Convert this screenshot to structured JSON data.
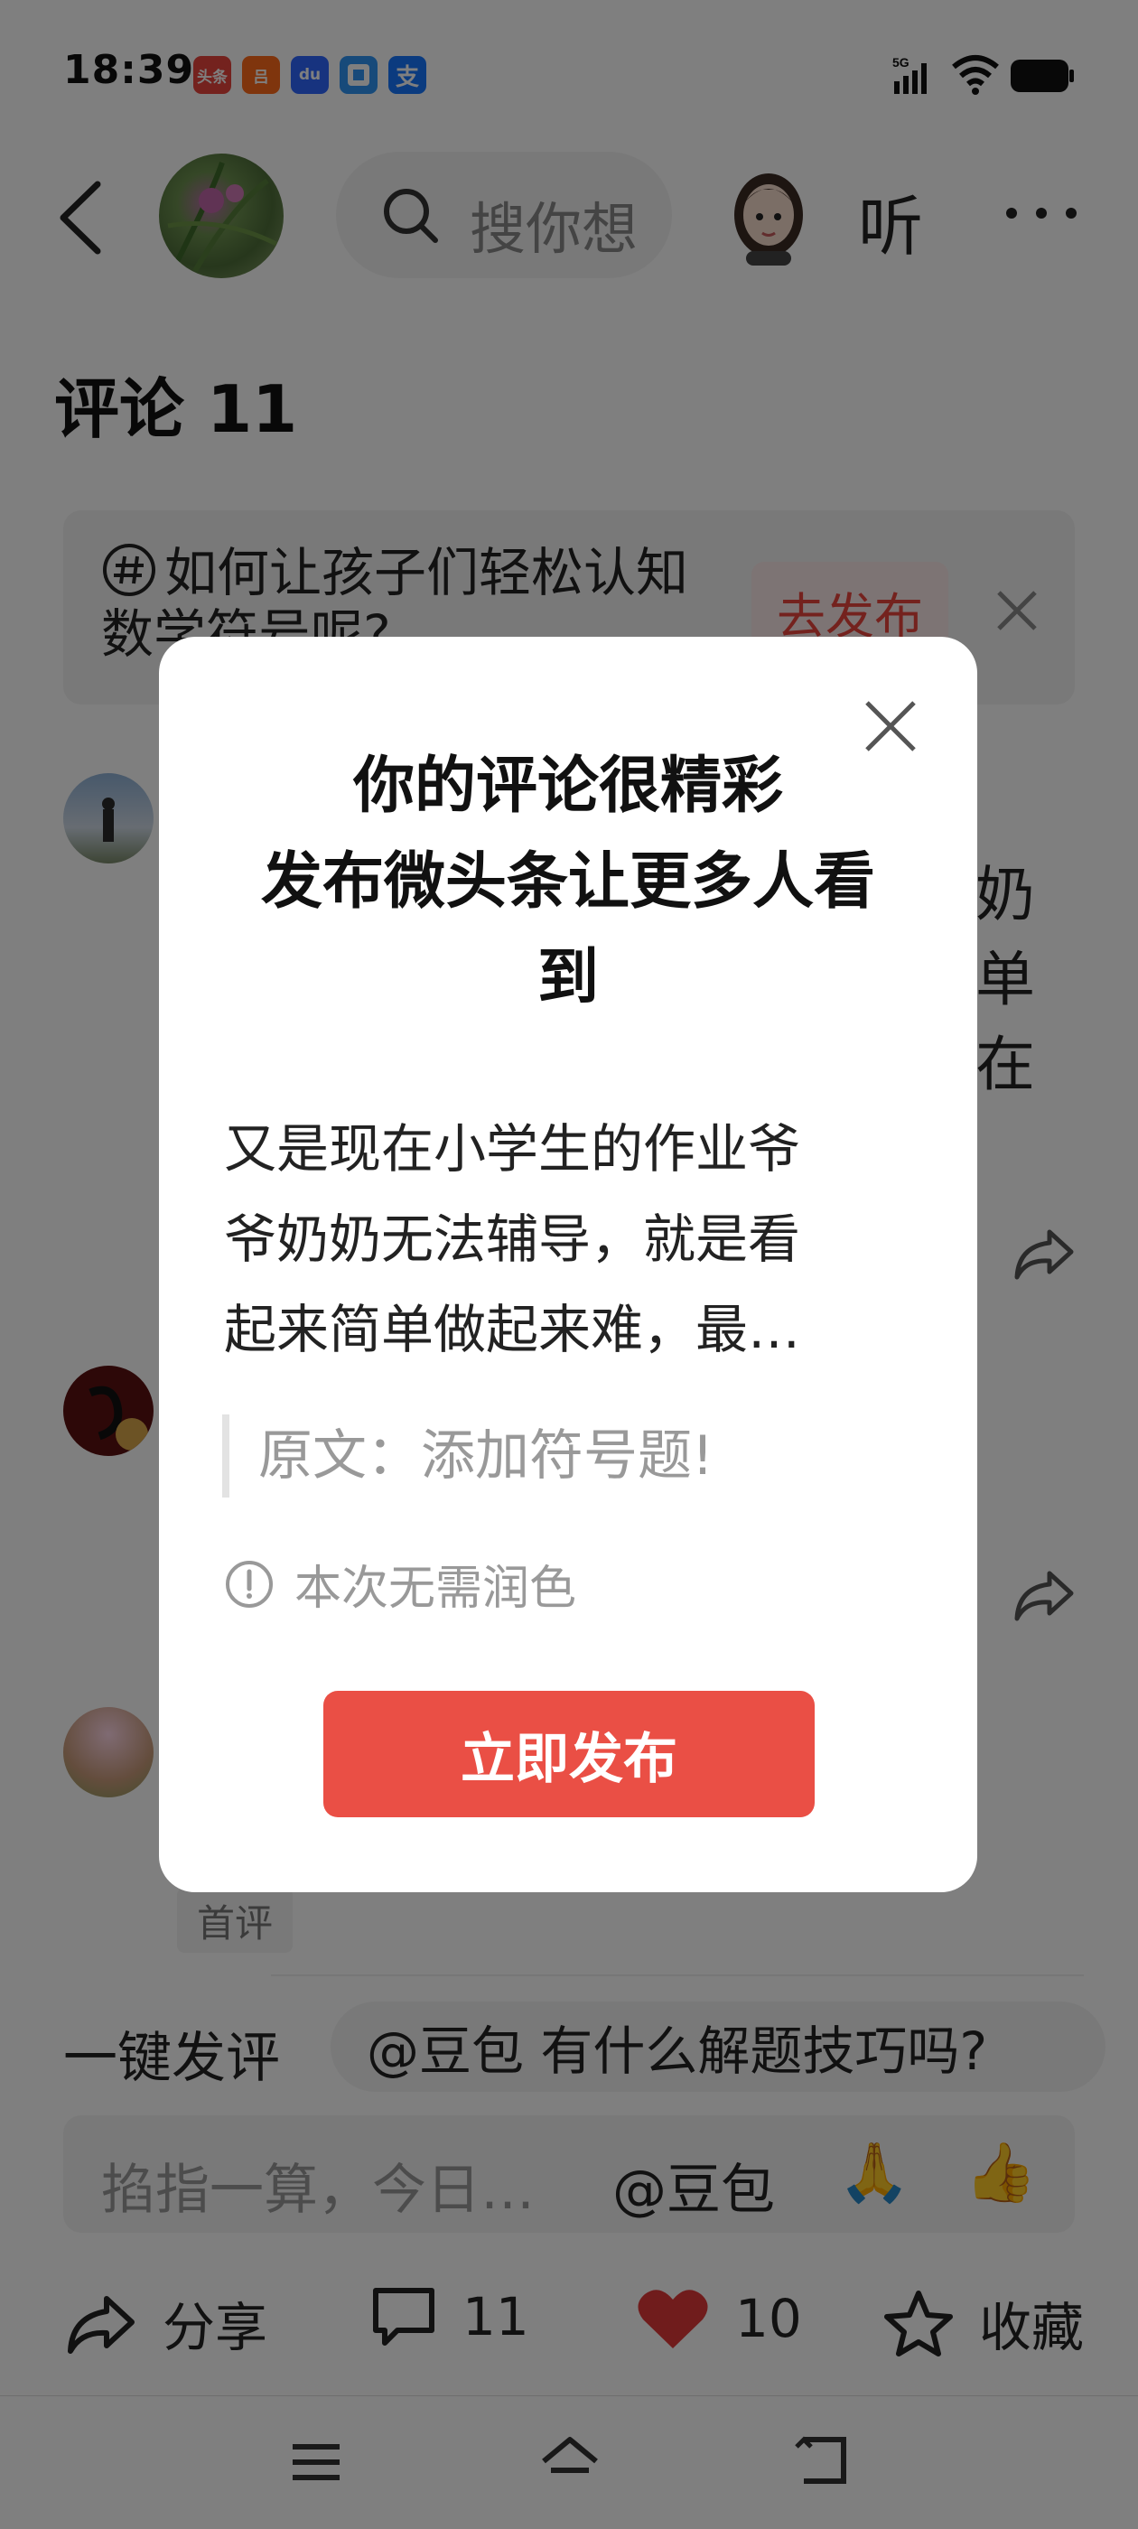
{
  "status_bar": {
    "time": "18:39",
    "app_icons": [
      {
        "name": "toutiao-app-icon",
        "label": "头条",
        "color": "#e8453c"
      },
      {
        "name": "taobao-app-icon",
        "label": "吕",
        "color": "#ff6a1a"
      },
      {
        "name": "baidu-app-icon",
        "label": "du",
        "color": "#2e66ff"
      },
      {
        "name": "app-icon-4",
        "label": "",
        "color": "#2f95f5"
      },
      {
        "name": "alipay-app-icon",
        "label": "支",
        "color": "#1677ff"
      }
    ],
    "network": "5G"
  },
  "header": {
    "search_placeholder": "搜你想",
    "listen_label": "听"
  },
  "comments": {
    "title": "评论 11"
  },
  "topic_banner": {
    "text": "如何让孩子们轻松认知数学符号呢?",
    "publish_label": "去发布"
  },
  "background_comments": [
    {
      "lines": [
        "奶",
        "单",
        "在"
      ]
    }
  ],
  "first_comment_badge": "首评",
  "quick_reply": {
    "label": "一键发评",
    "suggestion": "@豆包 有什么解题技巧吗?"
  },
  "input_bar": {
    "placeholder": "掐指一算，今日…",
    "at_label": "@豆包",
    "emoji_1": "🙏",
    "emoji_2": "👍"
  },
  "action_bar": {
    "share_label": "分享",
    "comment_count": "11",
    "like_count": "10",
    "favorite_label": "收藏"
  },
  "dialog": {
    "title_line1": "你的评论很精彩",
    "title_line2": "发布微头条让更多人看",
    "title_line3": "到",
    "body_line1": "又是现在小学生的作业爷",
    "body_line2": "爷奶奶无法辅导，就是看",
    "body_line3": "起来简单做起来难，最…",
    "original_text": "原文：添加符号题!",
    "hint": "本次无需润色",
    "publish_button": "立即发布"
  },
  "colors": {
    "accent_red": "#ea4f45",
    "like_red": "#e03838",
    "overlay": "rgba(0,0,0,0.5)"
  }
}
